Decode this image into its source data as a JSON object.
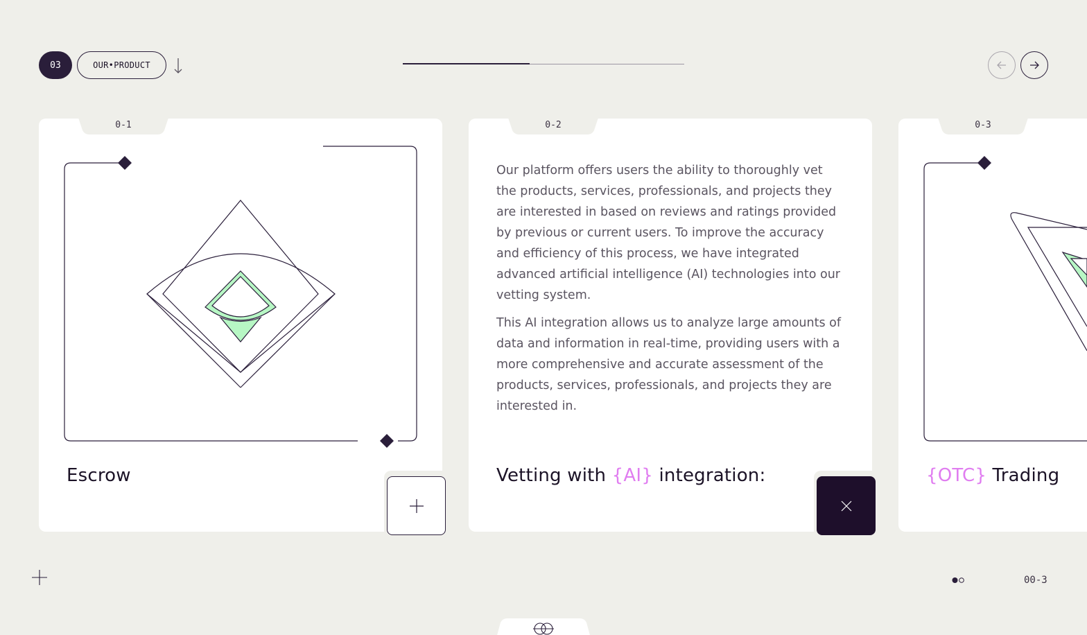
{
  "header": {
    "section_number": "03",
    "section_label": "OUR•PRODUCT",
    "progress": 0.45,
    "nav": {
      "prev_enabled": false,
      "next_enabled": true
    }
  },
  "cards": [
    {
      "index": "0-1",
      "title": "Escrow",
      "action": "expand"
    },
    {
      "index": "0-2",
      "title_before": "Vetting with ",
      "title_accent": "{AI}",
      "title_after": " integration:",
      "description": [
        "Our platform offers users the ability to thoroughly vet the products, services, professionals, and projects they are interested in based on reviews and ratings provided by previous or current users. To improve the accuracy and efficiency of this process, we have integrated advanced artificial intelligence (AI) technologies into our vetting system.",
        "This AI integration allows us to analyze large amounts of data and information in real-time, providing users with a more comprehensive and accurate assessment of the products, services, professionals, and projects they are interested in."
      ],
      "action": "close"
    },
    {
      "index": "0-3",
      "title_accent": "{OTC}",
      "title_after": " Trading"
    }
  ],
  "footer": {
    "page_count": "00-3"
  },
  "colors": {
    "background": "#efefea",
    "dark": "#1e0f2b",
    "accent": "#e07df0",
    "mint": "#b7f7c4"
  }
}
